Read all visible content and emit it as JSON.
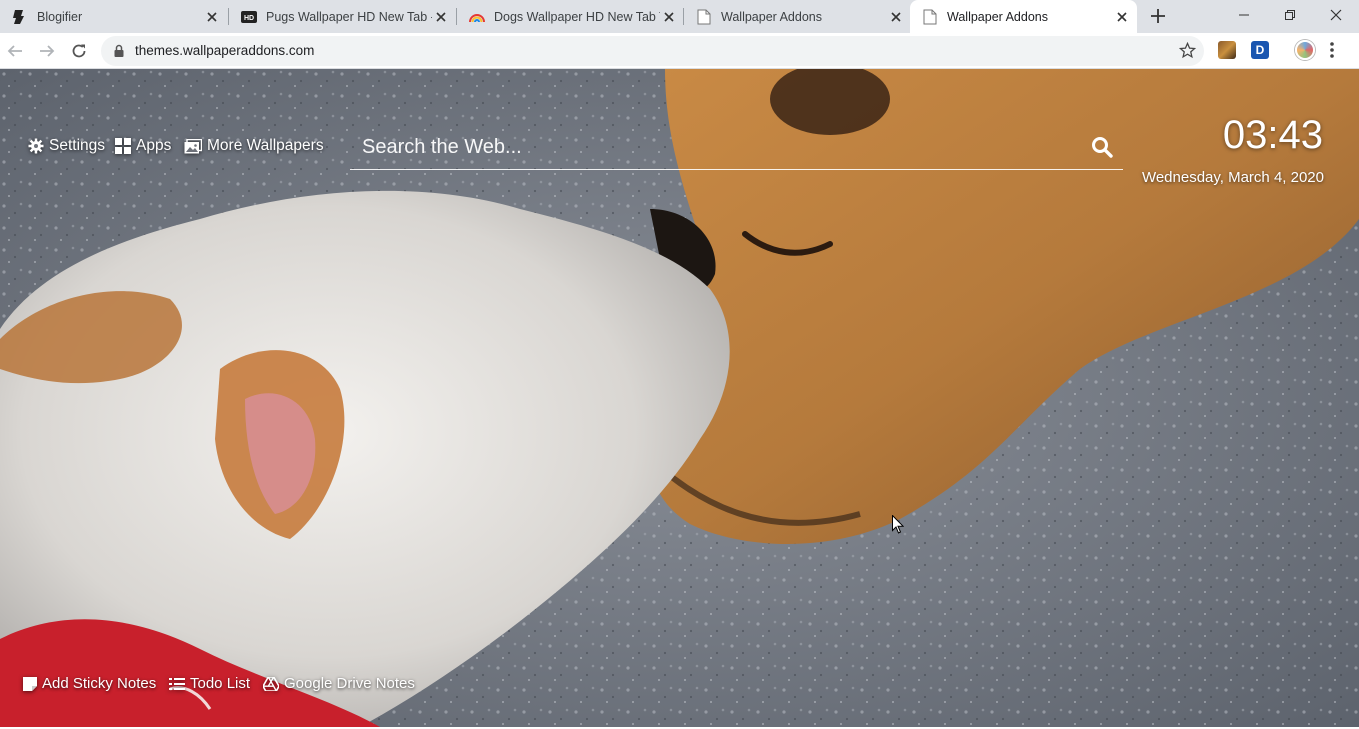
{
  "browser": {
    "tabs": [
      {
        "title": "Blogifier",
        "icon": "blogifier-icon"
      },
      {
        "title": "Pugs Wallpaper HD New Tab -",
        "icon": "hd-icon"
      },
      {
        "title": "Dogs Wallpaper HD New Tab T",
        "icon": "rainbow-icon"
      },
      {
        "title": "Wallpaper Addons",
        "icon": "page-icon"
      },
      {
        "title": "Wallpaper Addons",
        "icon": "page-icon"
      }
    ],
    "active_tab_index": 4,
    "url": "themes.wallpaperaddons.com",
    "extension_letter": "D",
    "colors": {
      "tab_strip": "#dee1e6",
      "omnibox": "#f1f3f4"
    }
  },
  "page": {
    "nav": {
      "settings_label": "Settings",
      "apps_label": "Apps",
      "more_wallpapers_label": "More Wallpapers"
    },
    "search": {
      "placeholder": "Search the Web..."
    },
    "clock": {
      "time": "03:43",
      "date": "Wednesday, March 4, 2020"
    },
    "bottom": {
      "sticky_notes_label": "Add Sticky Notes",
      "todo_label": "Todo List",
      "drive_notes_label": "Google Drive Notes"
    },
    "wallpaper": {
      "subject": "white terrier kissing tan dog on pavement"
    }
  }
}
